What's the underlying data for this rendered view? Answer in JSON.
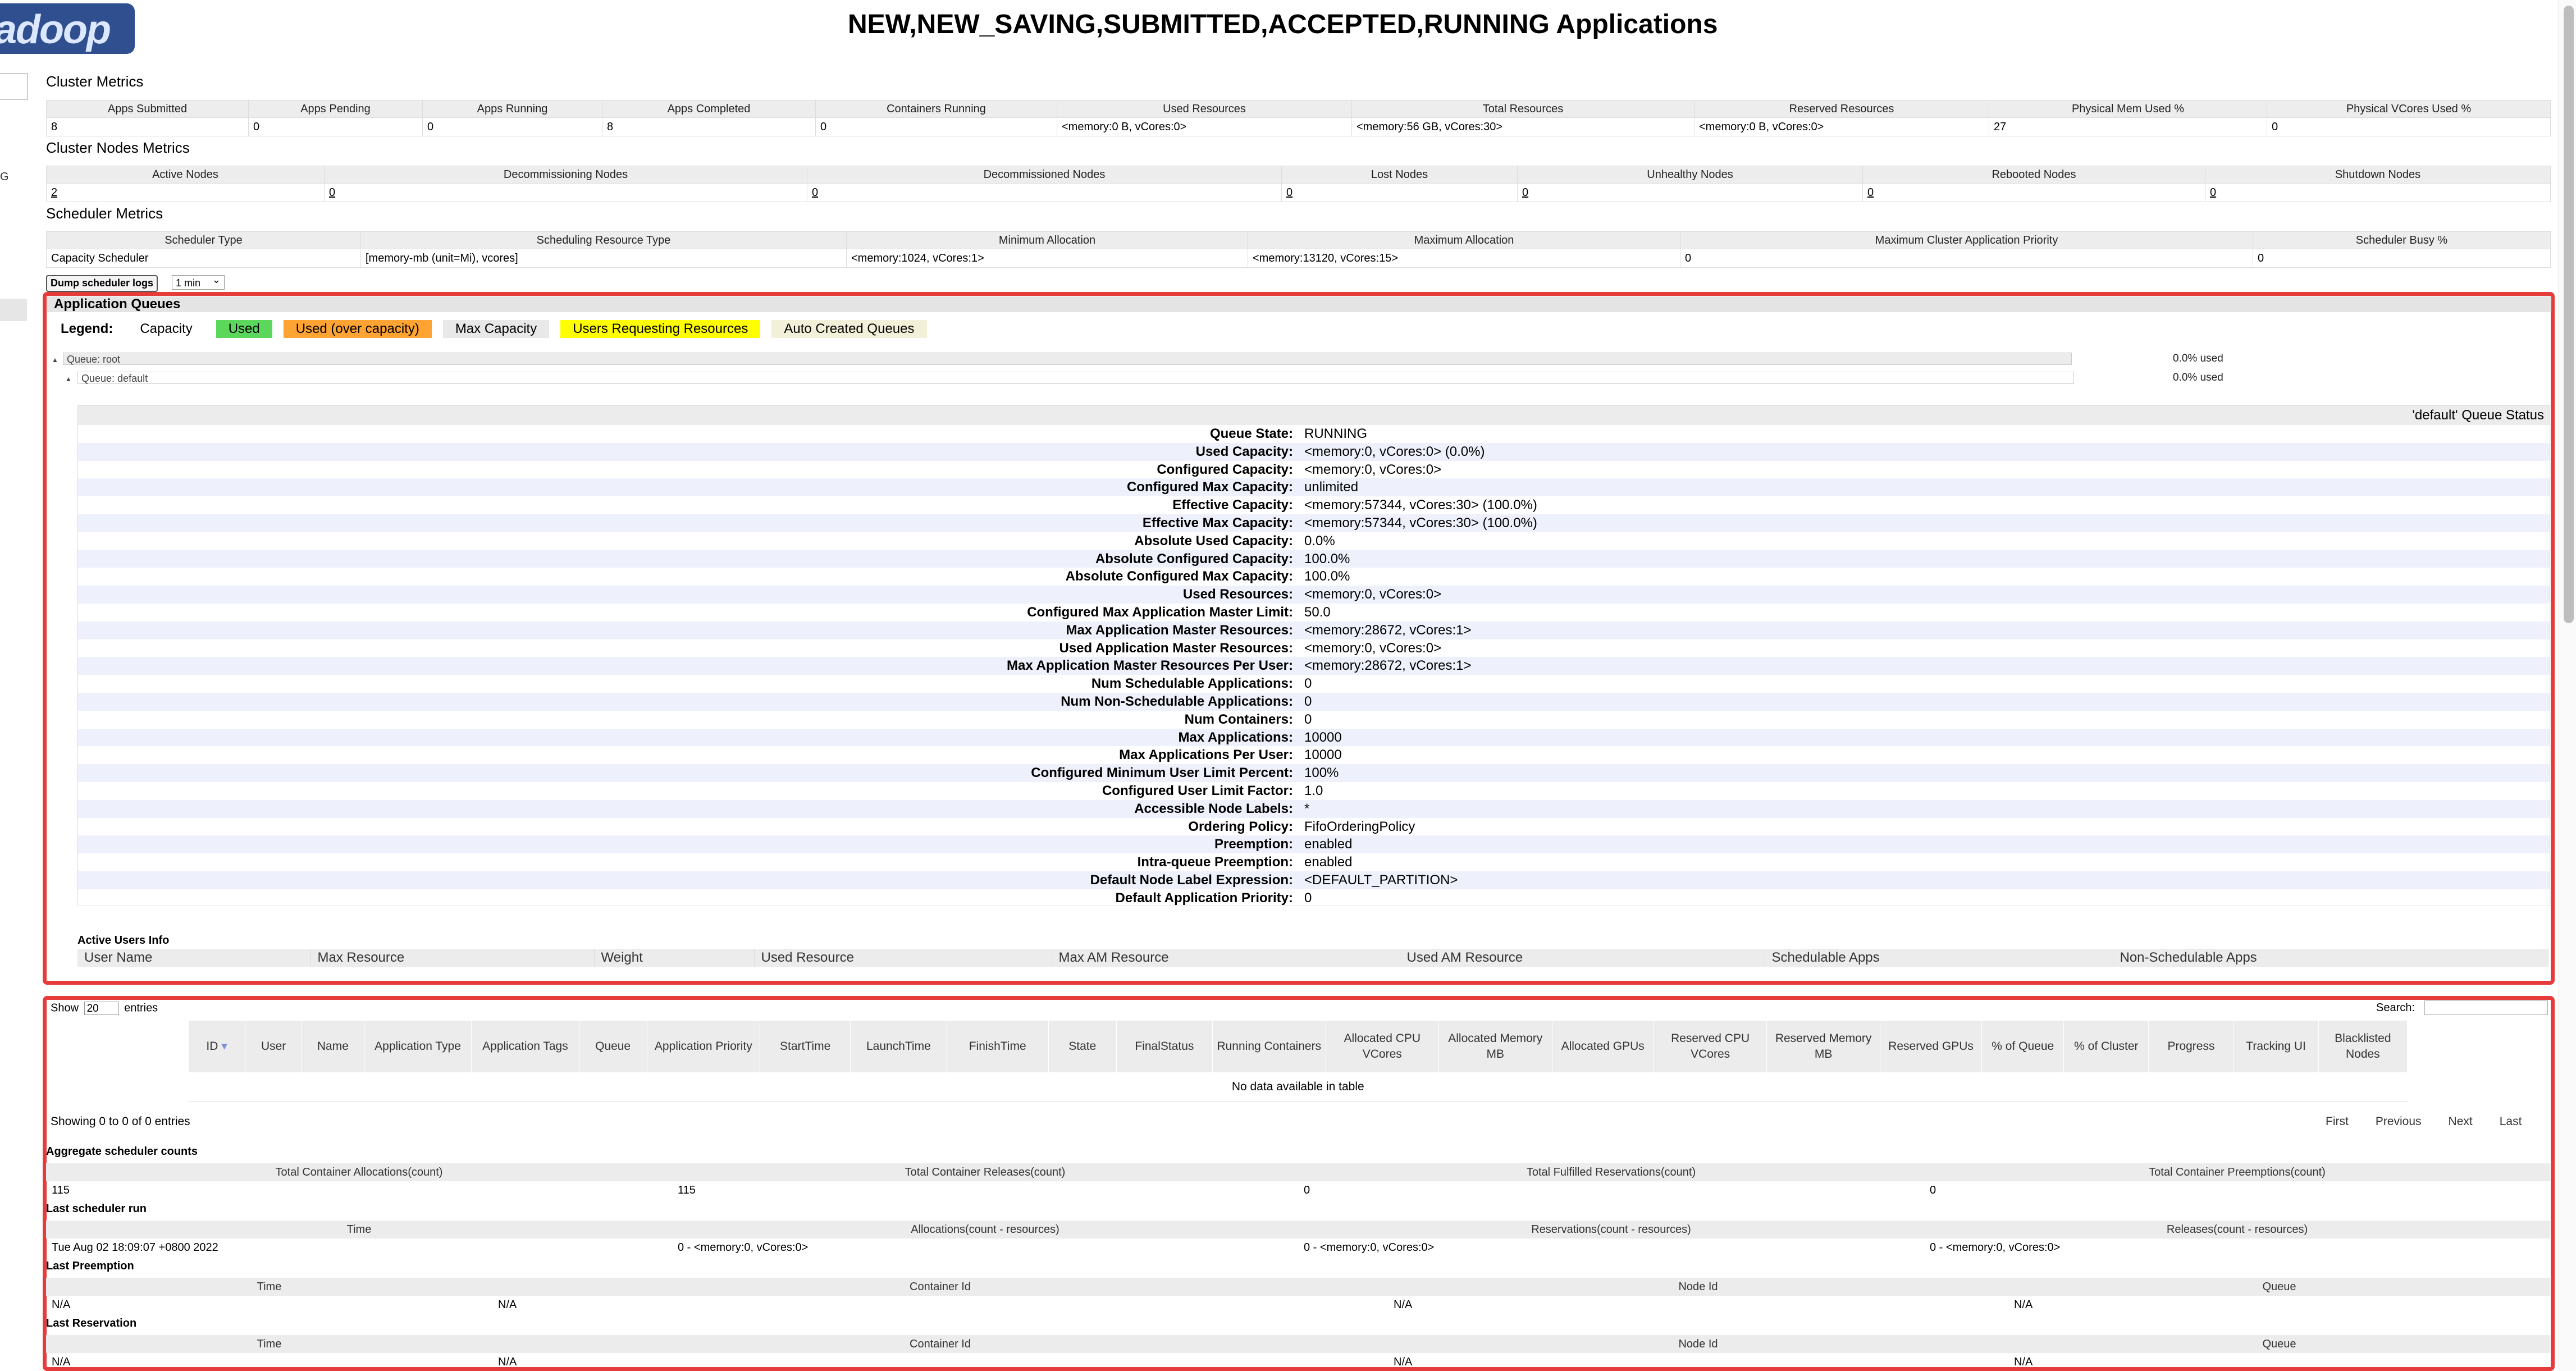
{
  "logo_text": "adoop",
  "page_title": "NEW,NEW_SAVING,SUBMITTED,ACCEPTED,RUNNING Applications",
  "left_nav_fragment": "G",
  "cluster_metrics": {
    "title": "Cluster Metrics",
    "headers": [
      "Apps Submitted",
      "Apps Pending",
      "Apps Running",
      "Apps Completed",
      "Containers Running",
      "Used Resources",
      "Total Resources",
      "Reserved Resources",
      "Physical Mem Used %",
      "Physical VCores Used %"
    ],
    "values": [
      "8",
      "0",
      "0",
      "8",
      "0",
      "<memory:0 B, vCores:0>",
      "<memory:56 GB, vCores:30>",
      "<memory:0 B, vCores:0>",
      "27",
      "0"
    ]
  },
  "cluster_nodes_metrics": {
    "title": "Cluster Nodes Metrics",
    "headers": [
      "Active Nodes",
      "Decommissioning Nodes",
      "Decommissioned Nodes",
      "Lost Nodes",
      "Unhealthy Nodes",
      "Rebooted Nodes",
      "Shutdown Nodes"
    ],
    "values": [
      "2",
      "0",
      "0",
      "0",
      "0",
      "0",
      "0"
    ]
  },
  "scheduler_metrics": {
    "title": "Scheduler Metrics",
    "headers": [
      "Scheduler Type",
      "Scheduling Resource Type",
      "Minimum Allocation",
      "Maximum Allocation",
      "Maximum Cluster Application Priority",
      "Scheduler Busy %"
    ],
    "values": [
      "Capacity Scheduler",
      "[memory-mb (unit=Mi), vcores]",
      "<memory:1024, vCores:1>",
      "<memory:13120, vCores:15>",
      "0",
      "0"
    ]
  },
  "dump": {
    "button": "Dump scheduler logs",
    "interval": "1 min"
  },
  "app_queues": {
    "title": "Application Queues",
    "legend_label": "Legend:",
    "legend": [
      {
        "label": "Capacity",
        "bg": "#ffffff"
      },
      {
        "label": "Used",
        "bg": "#5bd75b"
      },
      {
        "label": "Used (over capacity)",
        "bg": "#ffa333"
      },
      {
        "label": "Max Capacity",
        "bg": "#e8e8e8"
      },
      {
        "label": "Users Requesting Resources",
        "bg": "#ffff00"
      },
      {
        "label": "Auto Created Queues",
        "bg": "#f3f0d9"
      }
    ],
    "root_queue": "Queue: root",
    "root_used": "0.0% used",
    "default_queue": "Queue: default",
    "default_used": "0.0% used",
    "status_title": "'default' Queue Status",
    "status": [
      [
        "Queue State:",
        "RUNNING"
      ],
      [
        "Used Capacity:",
        "<memory:0, vCores:0> (0.0%)"
      ],
      [
        "Configured Capacity:",
        "<memory:0, vCores:0>"
      ],
      [
        "Configured Max Capacity:",
        "unlimited"
      ],
      [
        "Effective Capacity:",
        "<memory:57344, vCores:30> (100.0%)"
      ],
      [
        "Effective Max Capacity:",
        "<memory:57344, vCores:30> (100.0%)"
      ],
      [
        "Absolute Used Capacity:",
        "0.0%"
      ],
      [
        "Absolute Configured Capacity:",
        "100.0%"
      ],
      [
        "Absolute Configured Max Capacity:",
        "100.0%"
      ],
      [
        "Used Resources:",
        "<memory:0, vCores:0>"
      ],
      [
        "Configured Max Application Master Limit:",
        "50.0"
      ],
      [
        "Max Application Master Resources:",
        "<memory:28672, vCores:1>"
      ],
      [
        "Used Application Master Resources:",
        "<memory:0, vCores:0>"
      ],
      [
        "Max Application Master Resources Per User:",
        "<memory:28672, vCores:1>"
      ],
      [
        "Num Schedulable Applications:",
        "0"
      ],
      [
        "Num Non-Schedulable Applications:",
        "0"
      ],
      [
        "Num Containers:",
        "0"
      ],
      [
        "Max Applications:",
        "10000"
      ],
      [
        "Max Applications Per User:",
        "10000"
      ],
      [
        "Configured Minimum User Limit Percent:",
        "100%"
      ],
      [
        "Configured User Limit Factor:",
        "1.0"
      ],
      [
        "Accessible Node Labels:",
        "*"
      ],
      [
        "Ordering Policy:",
        "FifoOrderingPolicy"
      ],
      [
        "Preemption:",
        "enabled"
      ],
      [
        "Intra-queue Preemption:",
        "enabled"
      ],
      [
        "Default Node Label Expression:",
        "<DEFAULT_PARTITION>"
      ],
      [
        "Default Application Priority:",
        "0"
      ]
    ],
    "active_users_title": "Active Users Info",
    "active_users_headers": [
      "User Name",
      "Max Resource",
      "Weight",
      "Used Resource",
      "Max AM Resource",
      "Used AM Resource",
      "Schedulable Apps",
      "Non-Schedulable Apps"
    ]
  },
  "apps_table": {
    "show_label": "Show",
    "show_value": "20",
    "entries_label": "entries",
    "search_label": "Search:",
    "headers": [
      "ID",
      "User",
      "Name",
      "Application Type",
      "Application Tags",
      "Queue",
      "Application Priority",
      "StartTime",
      "LaunchTime",
      "FinishTime",
      "State",
      "FinalStatus",
      "Running Containers",
      "Allocated CPU VCores",
      "Allocated Memory MB",
      "Allocated GPUs",
      "Reserved CPU VCores",
      "Reserved Memory MB",
      "Reserved GPUs",
      "% of Queue",
      "% of Cluster",
      "Progress",
      "Tracking UI",
      "Blacklisted Nodes"
    ],
    "empty_message": "No data available in table",
    "showing": "Showing 0 to 0 of 0 entries",
    "pager": [
      "First",
      "Previous",
      "Next",
      "Last"
    ]
  },
  "aggregate": {
    "title": "Aggregate scheduler counts",
    "headers": [
      "Total Container Allocations(count)",
      "Total Container Releases(count)",
      "Total Fulfilled Reservations(count)",
      "Total Container Preemptions(count)"
    ],
    "values": [
      "115",
      "115",
      "0",
      "0"
    ]
  },
  "last_run": {
    "title": "Last scheduler run",
    "headers": [
      "Time",
      "Allocations(count - resources)",
      "Reservations(count - resources)",
      "Releases(count - resources)"
    ],
    "values": [
      "Tue Aug 02 18:09:07 +0800 2022",
      "0 - <memory:0, vCores:0>",
      "0 - <memory:0, vCores:0>",
      "0 - <memory:0, vCores:0>"
    ]
  },
  "last_preemption": {
    "title": "Last Preemption",
    "headers": [
      "Time",
      "Container Id",
      "Node Id",
      "Queue"
    ],
    "values": [
      "N/A",
      "N/A",
      "N/A",
      "N/A"
    ]
  },
  "last_reservation": {
    "title": "Last Reservation",
    "headers": [
      "Time",
      "Container Id",
      "Node Id",
      "Queue"
    ],
    "values": [
      "N/A",
      "N/A",
      "N/A",
      "N/A"
    ]
  }
}
